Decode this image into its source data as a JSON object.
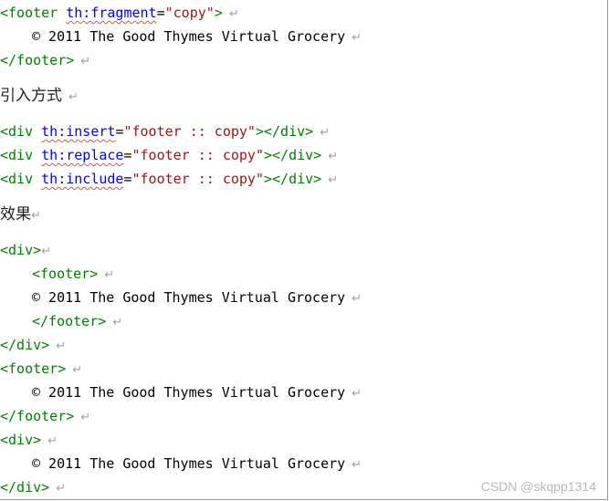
{
  "code_block_1": {
    "line1": {
      "open": "<footer ",
      "attr": "th:fragment",
      "eq": "=",
      "value": "\"copy\"",
      "close": ">"
    },
    "line2": {
      "text": "© 2011 The Good Thymes Virtual Grocery"
    },
    "line3": {
      "tag": "</footer>"
    }
  },
  "heading_import": "引入方式",
  "code_block_2": [
    {
      "open": "<div ",
      "attr": "th:insert",
      "eq": "=",
      "value": "\"footer :: copy\"",
      "close": "></div>"
    },
    {
      "open": "<div ",
      "attr": "th:replace",
      "eq": "=",
      "value": "\"footer :: copy\"",
      "close": "></div>"
    },
    {
      "open": "<div ",
      "attr": "th:include",
      "eq": "=",
      "value": "\"footer :: copy\"",
      "close": "></div>"
    }
  ],
  "heading_effect": "效果",
  "code_block_3": {
    "l1": "<div>",
    "l2": "<footer>",
    "l3": "© 2011 The Good Thymes Virtual Grocery",
    "l4": "</footer>",
    "l5": "</div>",
    "l6": "<footer>",
    "l7": "© 2011 The Good Thymes Virtual Grocery",
    "l8": "</footer>",
    "l9": "<div>",
    "l10": "© 2011 The Good Thymes Virtual Grocery",
    "l11": "</div>"
  },
  "paragraph_mark": "↵",
  "watermark": "CSDN @skqpp1314",
  "colors": {
    "tag": "#008000",
    "attribute": "#0000ff",
    "value": "#a31515",
    "spellcheck_underline": "#e0504f",
    "paragraph_mark": "#a0a0a0"
  }
}
